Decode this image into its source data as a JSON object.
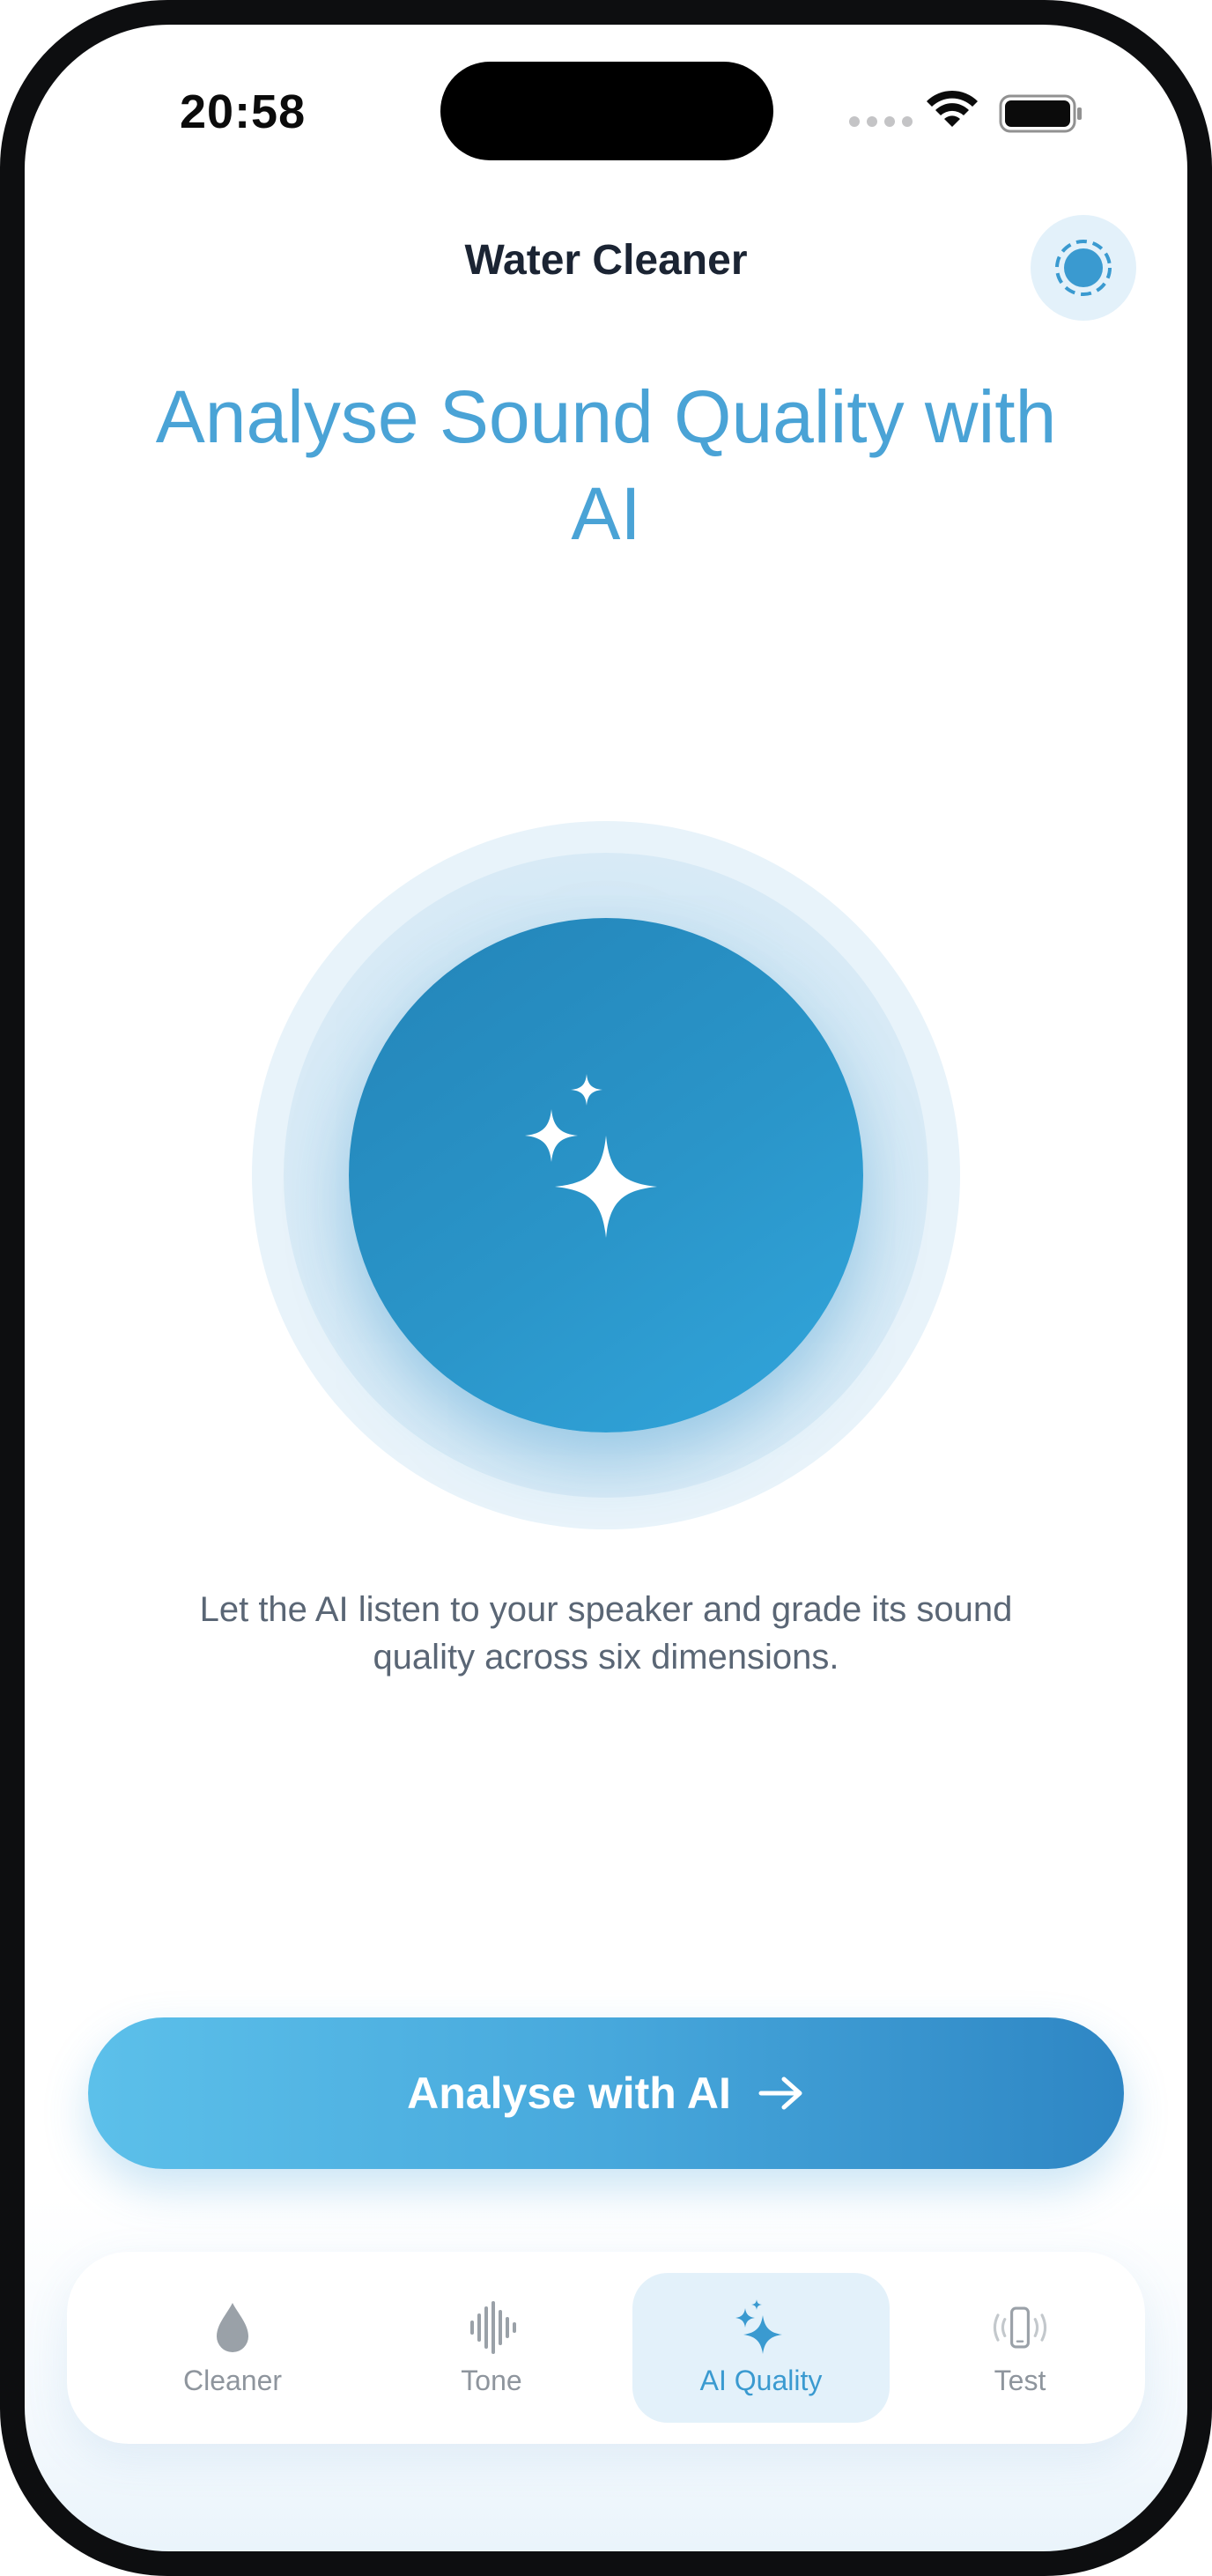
{
  "status_bar": {
    "time": "20:58"
  },
  "header": {
    "title": "Water Cleaner"
  },
  "main": {
    "title": "Analyse Sound Quality with AI",
    "description": "Let the AI listen to your speaker and grade its sound quality across six dimensions."
  },
  "cta": {
    "label": "Analyse with AI"
  },
  "tabs": [
    {
      "label": "Cleaner",
      "icon": "water-drop-icon",
      "active": false
    },
    {
      "label": "Tone",
      "icon": "waveform-icon",
      "active": false
    },
    {
      "label": "AI Quality",
      "icon": "sparkles-icon",
      "active": true
    },
    {
      "label": "Test",
      "icon": "phone-vibrate-icon",
      "active": false
    }
  ],
  "colors": {
    "accent": "#4aa3d6",
    "orb": "#2a95c9",
    "cta_start": "#5cc0ea",
    "cta_end": "#2e86c4",
    "tab_inactive": "#8e959d",
    "tab_active": "#3a9ad0"
  }
}
